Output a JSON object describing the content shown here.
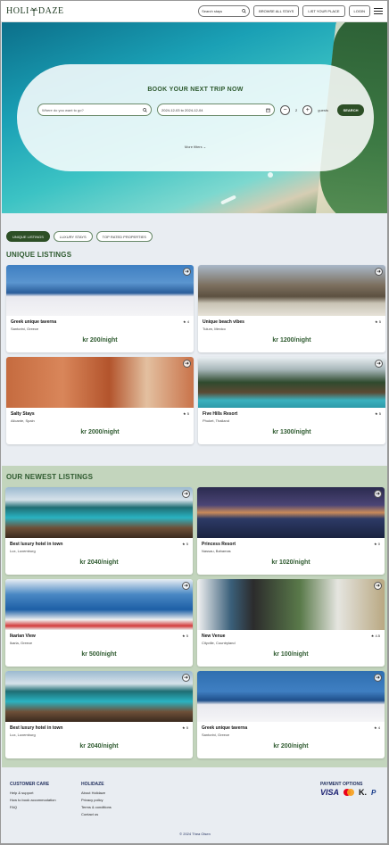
{
  "header": {
    "logo_left": "HOLI",
    "logo_right": "DAZE",
    "search_placeholder": "Search stays",
    "browse_label": "BROWSE ALL STAYS",
    "list_label": "LIST YOUR PLACE",
    "login_label": "LOGIN"
  },
  "hero": {
    "title": "BOOK YOUR NEXT TRIP NOW",
    "where_placeholder": "Where do you want to go?",
    "dates": "2024-12-03 to 2024-12-04",
    "guests_count": "2",
    "guests_label": "guests",
    "minus": "−",
    "plus": "+",
    "search_label": "SEARCH",
    "more_filters": "More filters"
  },
  "tabs": [
    "UNIQUE LISTINGS",
    "LUXURY STAYS",
    "TOP RATED PROPERTIES"
  ],
  "unique": {
    "title": "UNIQUE LISTINGS",
    "items": [
      {
        "name": "Greek unique taverna",
        "location": "Santorini, Greece",
        "rating": "4",
        "price": "kr 200/night"
      },
      {
        "name": "Unique beach vibes",
        "location": "Tulum, Mexico",
        "rating": "5",
        "price": "kr 1200/night"
      },
      {
        "name": "Salty Stays",
        "location": "Alicante, Spain",
        "rating": "5",
        "price": "kr 2000/night"
      },
      {
        "name": "Five Hills Resort",
        "location": "Phuket, Thailand",
        "rating": "5",
        "price": "kr 1300/night"
      }
    ]
  },
  "newest": {
    "title": "OUR NEWEST LISTINGS",
    "items": [
      {
        "name": "Best luxury hotel in town",
        "location": "Lux, Luxemburg",
        "rating": "5",
        "price": "kr 2040/night"
      },
      {
        "name": "Princess Resort",
        "location": "Nassau, Bahamas",
        "rating": "0",
        "price": "kr 1020/night"
      },
      {
        "name": "Ikarian View",
        "location": "Ikaria, Greece",
        "rating": "5",
        "price": "kr 500/night"
      },
      {
        "name": "New Venue",
        "location": "Cityville, Countryland",
        "rating": "4.5",
        "price": "kr 100/night"
      },
      {
        "name": "Best luxury hotel in town",
        "location": "Lux, Luxemburg",
        "rating": "5",
        "price": "kr 2040/night"
      },
      {
        "name": "Greek unique taverna",
        "location": "Santorini, Greece",
        "rating": "4",
        "price": "kr 200/night"
      }
    ]
  },
  "footer": {
    "customer_care_title": "CUSTOMER CARE",
    "customer_care_links": [
      "Help & support",
      "How to book accommodation",
      "FAQ"
    ],
    "holidaze_title": "HOLIDAZE",
    "holidaze_links": [
      "About Holidaze",
      "Privacy policy",
      "Terms & conditions",
      "Contact us"
    ],
    "payment_title": "PAYMENT OPTIONS",
    "visa": "VISA",
    "klarna": "K.",
    "paypal": "P",
    "copyright": "© 2024 Thea Olsen"
  },
  "icons": {
    "search": "search-icon",
    "calendar": "calendar-icon",
    "chevron": "chevron-down-icon",
    "arrow": "arrow-right-icon",
    "star": "star-icon",
    "menu": "hamburger-menu-icon",
    "palm": "palm-tree-icon"
  },
  "colors": {
    "brand_green": "#2d4f26",
    "title_green": "#2e5a2f",
    "newest_bg": "#c3d5bd",
    "footer_navy": "#1f2d5c"
  }
}
